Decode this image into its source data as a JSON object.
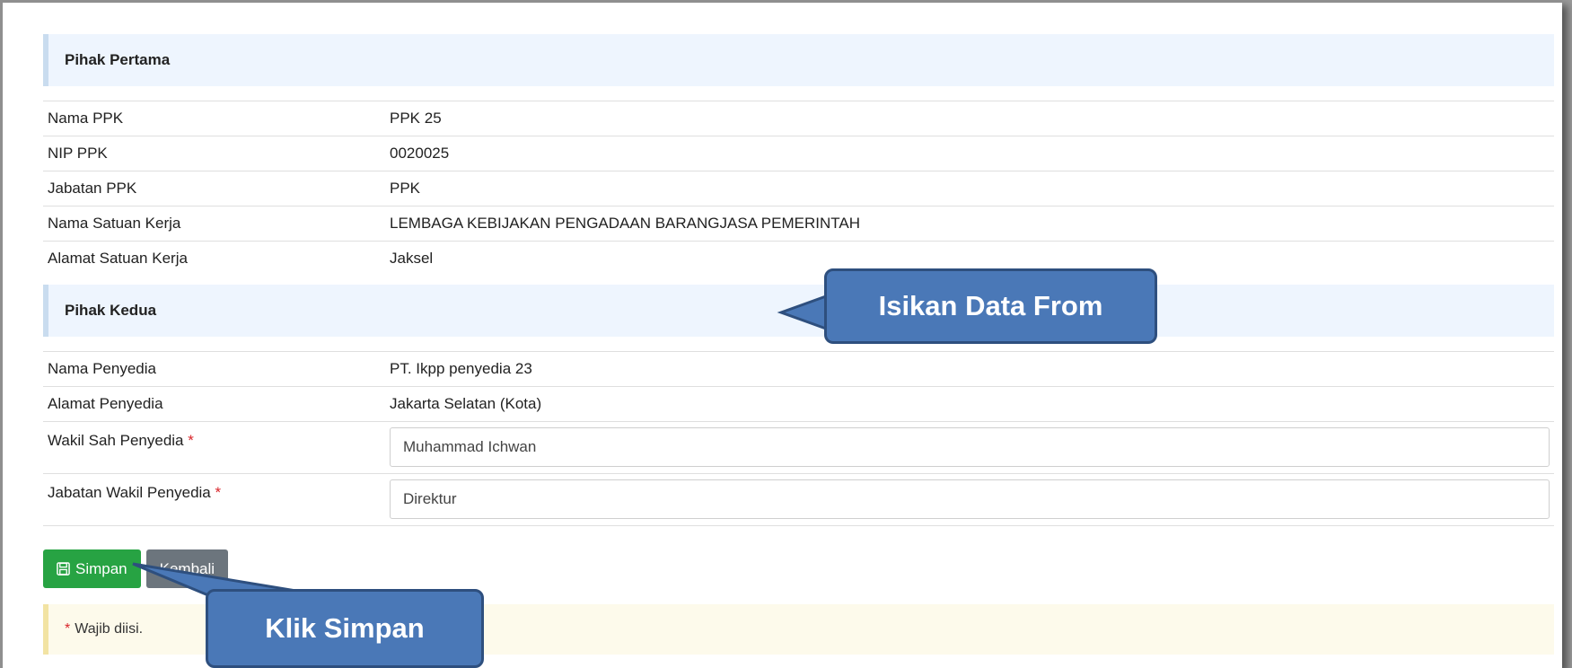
{
  "pihak_pertama": {
    "title": "Pihak Pertama",
    "rows": [
      {
        "label": "Nama PPK",
        "value": "PPK 25"
      },
      {
        "label": "NIP PPK",
        "value": "0020025"
      },
      {
        "label": "Jabatan PPK",
        "value": "PPK"
      },
      {
        "label": "Nama Satuan Kerja",
        "value": "LEMBAGA KEBIJAKAN PENGADAAN BARANGJASA PEMERINTAH"
      },
      {
        "label": "Alamat Satuan Kerja",
        "value": "Jaksel"
      }
    ]
  },
  "pihak_kedua": {
    "title": "Pihak Kedua",
    "rows": [
      {
        "label": "Nama Penyedia",
        "value": "PT. Ikpp penyedia 23"
      },
      {
        "label": "Alamat Penyedia",
        "value": "Jakarta Selatan (Kota)"
      }
    ],
    "wakil_sah": {
      "label": "Wakil Sah Penyedia",
      "required_mark": "*",
      "value": "Muhammad Ichwan"
    },
    "jabatan_wakil": {
      "label": "Jabatan Wakil Penyedia",
      "required_mark": "*",
      "value": "Direktur"
    }
  },
  "buttons": {
    "save_icon": "save-icon",
    "save_label": "Simpan",
    "back_label": "Kembali"
  },
  "note": {
    "mark": "*",
    "text": "Wajib diisi."
  },
  "callouts": {
    "isikan": "Isikan Data From",
    "klik": "Klik Simpan"
  },
  "colors": {
    "save": "#27a343",
    "back": "#6c757d",
    "callout": "#4a78b7",
    "required": "#d9262b"
  }
}
